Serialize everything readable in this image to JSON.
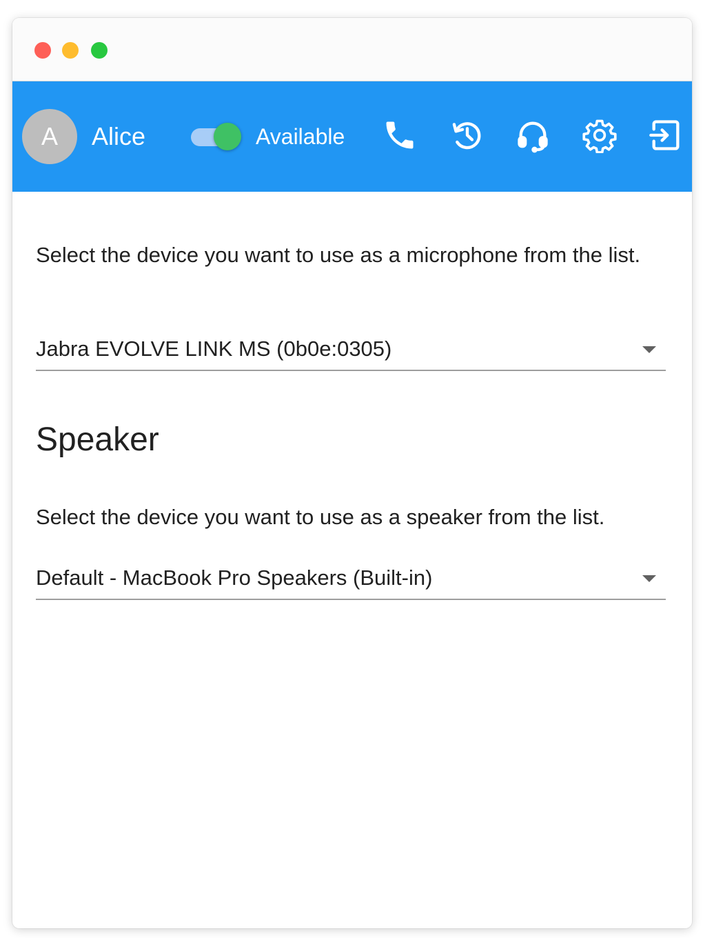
{
  "header": {
    "avatar_initial": "A",
    "user_name": "Alice",
    "status_label": "Available",
    "status_available": true,
    "colors": {
      "appbar": "#2196f3",
      "switch_on": "#3fc164",
      "avatar": "#bdbdbd"
    },
    "icons": [
      "phone-icon",
      "history-icon",
      "headset-icon",
      "gear-icon",
      "logout-icon"
    ]
  },
  "microphone": {
    "description": "Select the device you want to use as a microphone from the list.",
    "selected_device": "Jabra EVOLVE LINK MS (0b0e:0305)"
  },
  "speaker": {
    "heading": "Speaker",
    "description": "Select the device you want to use as a speaker from the list.",
    "selected_device": "Default - MacBook Pro Speakers (Built-in)"
  }
}
